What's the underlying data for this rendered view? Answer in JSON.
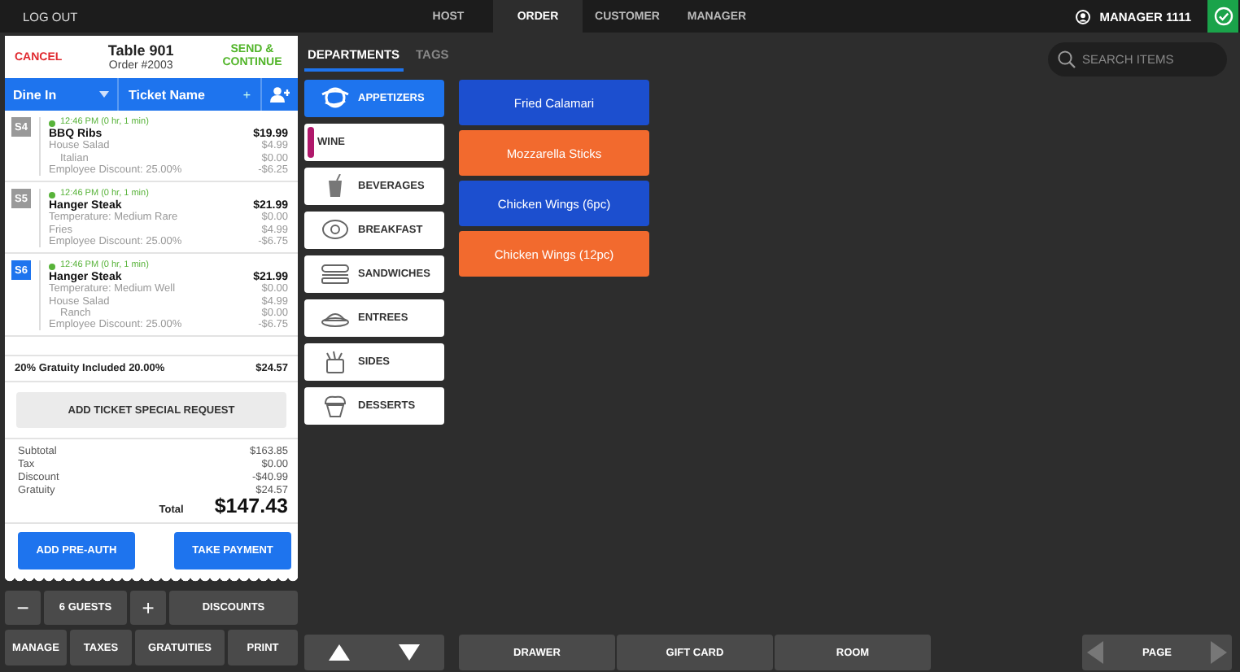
{
  "top_bar": {
    "logout": "LOG OUT",
    "tabs": [
      {
        "label": "HOST",
        "selected": false
      },
      {
        "label": "ORDER",
        "selected": true
      },
      {
        "label": "CUSTOMER",
        "selected": false
      },
      {
        "label": "MANAGER",
        "selected": false
      }
    ],
    "user": "MANAGER 1111"
  },
  "ticket": {
    "cancel": "CANCEL",
    "table": "Table 901",
    "order": "Order #2003",
    "send": "SEND & CONTINUE",
    "dine_option": "Dine In",
    "ticket_name": "Ticket Name",
    "ticket_name_add": "+",
    "items": [
      {
        "seat": "S4",
        "selected": false,
        "time": "12:46 PM (0 hr, 1 min)",
        "name": "BBQ Ribs",
        "price": "$19.99",
        "modifiers": [
          {
            "name": "House Salad",
            "price": "$4.99",
            "children": [
              {
                "name": "Italian",
                "price": "$0.00"
              }
            ]
          },
          {
            "name": "Employee Discount: 25.00%",
            "price": "-$6.25"
          }
        ]
      },
      {
        "seat": "S5",
        "selected": false,
        "time": "12:46 PM (0 hr, 1 min)",
        "name": "Hanger Steak",
        "price": "$21.99",
        "modifiers": [
          {
            "name": "Temperature: Medium Rare",
            "price": "$0.00"
          },
          {
            "name": "Fries",
            "price": "$4.99"
          },
          {
            "name": "Employee Discount: 25.00%",
            "price": "-$6.75"
          }
        ]
      },
      {
        "seat": "S6",
        "selected": true,
        "time": "12:46 PM (0 hr, 1 min)",
        "name": "Hanger Steak",
        "price": "$21.99",
        "modifiers": [
          {
            "name": "Temperature: Medium Well",
            "price": "$0.00"
          },
          {
            "name": "House Salad",
            "price": "$4.99",
            "children": [
              {
                "name": "Ranch",
                "price": "$0.00"
              }
            ]
          },
          {
            "name": "Employee Discount: 25.00%",
            "price": "-$6.75"
          }
        ]
      }
    ],
    "gratuity": {
      "label": "20% Gratuity Included 20.00%",
      "amount": "$24.57"
    },
    "special_request": "ADD TICKET SPECIAL REQUEST",
    "totals": [
      {
        "label": "Subtotal",
        "value": "$163.85"
      },
      {
        "label": "Tax",
        "value": "$0.00"
      },
      {
        "label": "Discount",
        "value": "-$40.99"
      },
      {
        "label": "Gratuity",
        "value": "$24.57"
      }
    ],
    "total": {
      "label": "Total",
      "value": "$147.43"
    },
    "buttons": [
      "ADD PRE-AUTH",
      "TAKE PAYMENT"
    ]
  },
  "guest_controls": {
    "minus": "−",
    "guests": "6 GUESTS",
    "plus": "+",
    "discounts": "DISCOUNTS"
  },
  "actions": [
    "MANAGE",
    "TAXES",
    "GRATUITIES",
    "PRINT"
  ],
  "catalog_tabs": [
    {
      "label": "DEPARTMENTS",
      "selected": true
    },
    {
      "label": "TAGS",
      "selected": false
    }
  ],
  "search": {
    "placeholder": "SEARCH ITEMS"
  },
  "departments": [
    {
      "kind": "icon",
      "label": "APPETIZERS",
      "selected": true
    },
    {
      "kind": "color",
      "label": "WINE",
      "color": "#b0186b",
      "selected": false
    },
    {
      "kind": "icon",
      "label": "BEVERAGES",
      "selected": false
    },
    {
      "kind": "icon",
      "label": "BREAKFAST",
      "selected": false
    },
    {
      "kind": "icon",
      "label": "SANDWICHES",
      "selected": false
    },
    {
      "kind": "icon",
      "label": "ENTREES",
      "selected": false
    },
    {
      "kind": "icon",
      "label": "SIDES",
      "selected": false
    },
    {
      "kind": "icon",
      "label": "DESSERTS",
      "selected": false
    }
  ],
  "menu_items": [
    {
      "label": "Fried Calamari",
      "color": "#1c4fcf"
    },
    {
      "label": "Mozzarella Sticks",
      "color": "#f26a2e"
    },
    {
      "label": "Chicken Wings (6pc)",
      "color": "#1c4fcf"
    },
    {
      "label": "Chicken Wings (12pc)",
      "color": "#f26a2e"
    }
  ],
  "bottom_bar": {
    "buttons": [
      "DRAWER",
      "GIFT CARD",
      "ROOM"
    ],
    "page": "PAGE"
  }
}
